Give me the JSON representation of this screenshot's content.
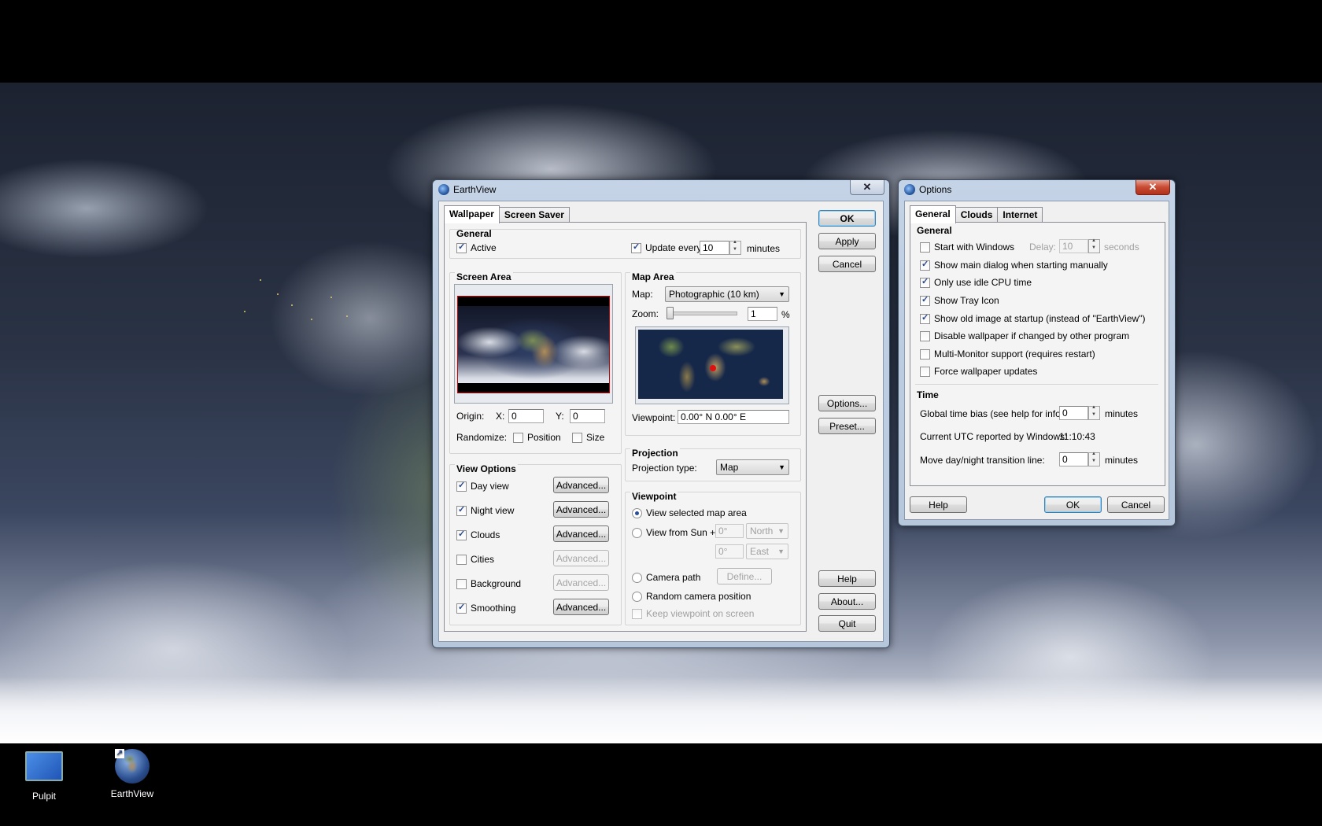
{
  "desktop": {
    "icons": [
      {
        "label": "Pulpit",
        "icon": "monitor-icon"
      },
      {
        "label": "EarthView",
        "icon": "globe-icon"
      }
    ]
  },
  "earthview": {
    "title": "EarthView",
    "close_glyph": "✕",
    "tabs": [
      "Wallpaper",
      "Screen Saver"
    ],
    "general": {
      "title": "General",
      "active_label": "Active",
      "active_checked": true,
      "update_label": "Update every",
      "update_checked": true,
      "update_value": "10",
      "update_unit": "minutes"
    },
    "screen_area": {
      "title": "Screen Area",
      "origin_label": "Origin:",
      "x_label": "X:",
      "x_value": "0",
      "y_label": "Y:",
      "y_value": "0",
      "randomize_label": "Randomize:",
      "position_label": "Position",
      "size_label": "Size"
    },
    "map_area": {
      "title": "Map Area",
      "map_label": "Map:",
      "map_value": "Photographic (10 km)",
      "zoom_label": "Zoom:",
      "zoom_value": "1",
      "zoom_unit": "%",
      "viewpoint_label": "Viewpoint:",
      "viewpoint_value": "0.00° N   0.00° E"
    },
    "view_options": {
      "title": "View Options",
      "items": [
        {
          "label": "Day view",
          "checked": true,
          "button": "Advanced...",
          "enabled": true
        },
        {
          "label": "Night view",
          "checked": true,
          "button": "Advanced...",
          "enabled": true
        },
        {
          "label": "Clouds",
          "checked": true,
          "button": "Advanced...",
          "enabled": true
        },
        {
          "label": "Cities",
          "checked": false,
          "button": "Advanced...",
          "enabled": false
        },
        {
          "label": "Background",
          "checked": false,
          "button": "Advanced...",
          "enabled": false
        },
        {
          "label": "Smoothing",
          "checked": true,
          "button": "Advanced...",
          "enabled": true
        }
      ]
    },
    "projection": {
      "title": "Projection",
      "type_label": "Projection type:",
      "type_value": "Map"
    },
    "viewpoint": {
      "title": "Viewpoint",
      "selected_map": "View selected map area",
      "from_sun": "View from Sun +",
      "lat_value": "0°",
      "lat_dir": "North",
      "lon_value": "0°",
      "lon_dir": "East",
      "camera_path": "Camera path",
      "define": "Define...",
      "random_camera": "Random camera position",
      "keep_viewpoint": "Keep viewpoint on screen"
    },
    "buttons": {
      "ok": "OK",
      "apply": "Apply",
      "cancel": "Cancel",
      "options": "Options...",
      "preset": "Preset...",
      "help": "Help",
      "about": "About...",
      "quit": "Quit"
    }
  },
  "options": {
    "title": "Options",
    "close_glyph": "✕",
    "tabs": [
      "General",
      "Clouds",
      "Internet"
    ],
    "general": {
      "title": "General",
      "items": [
        {
          "label": "Start with Windows",
          "checked": false
        },
        {
          "label": "Show main dialog when starting manually",
          "checked": true
        },
        {
          "label": "Only use idle CPU time",
          "checked": true
        },
        {
          "label": "Show Tray Icon",
          "checked": true
        },
        {
          "label": "Show old image at startup (instead of \"EarthView\")",
          "checked": true
        },
        {
          "label": "Disable wallpaper if changed by other program",
          "checked": false
        },
        {
          "label": "Multi-Monitor support (requires restart)",
          "checked": false
        },
        {
          "label": "Force wallpaper updates",
          "checked": false
        }
      ],
      "delay_label": "Delay:",
      "delay_value": "10",
      "delay_unit": "seconds"
    },
    "time": {
      "title": "Time",
      "bias_label": "Global time bias (see help for info):",
      "bias_value": "0",
      "bias_unit": "minutes",
      "utc_label": "Current UTC reported by Windows:",
      "utc_value": "11:10:43",
      "transition_label": "Move day/night transition line:",
      "transition_value": "0",
      "transition_unit": "minutes"
    },
    "buttons": {
      "help": "Help",
      "ok": "OK",
      "cancel": "Cancel"
    }
  }
}
